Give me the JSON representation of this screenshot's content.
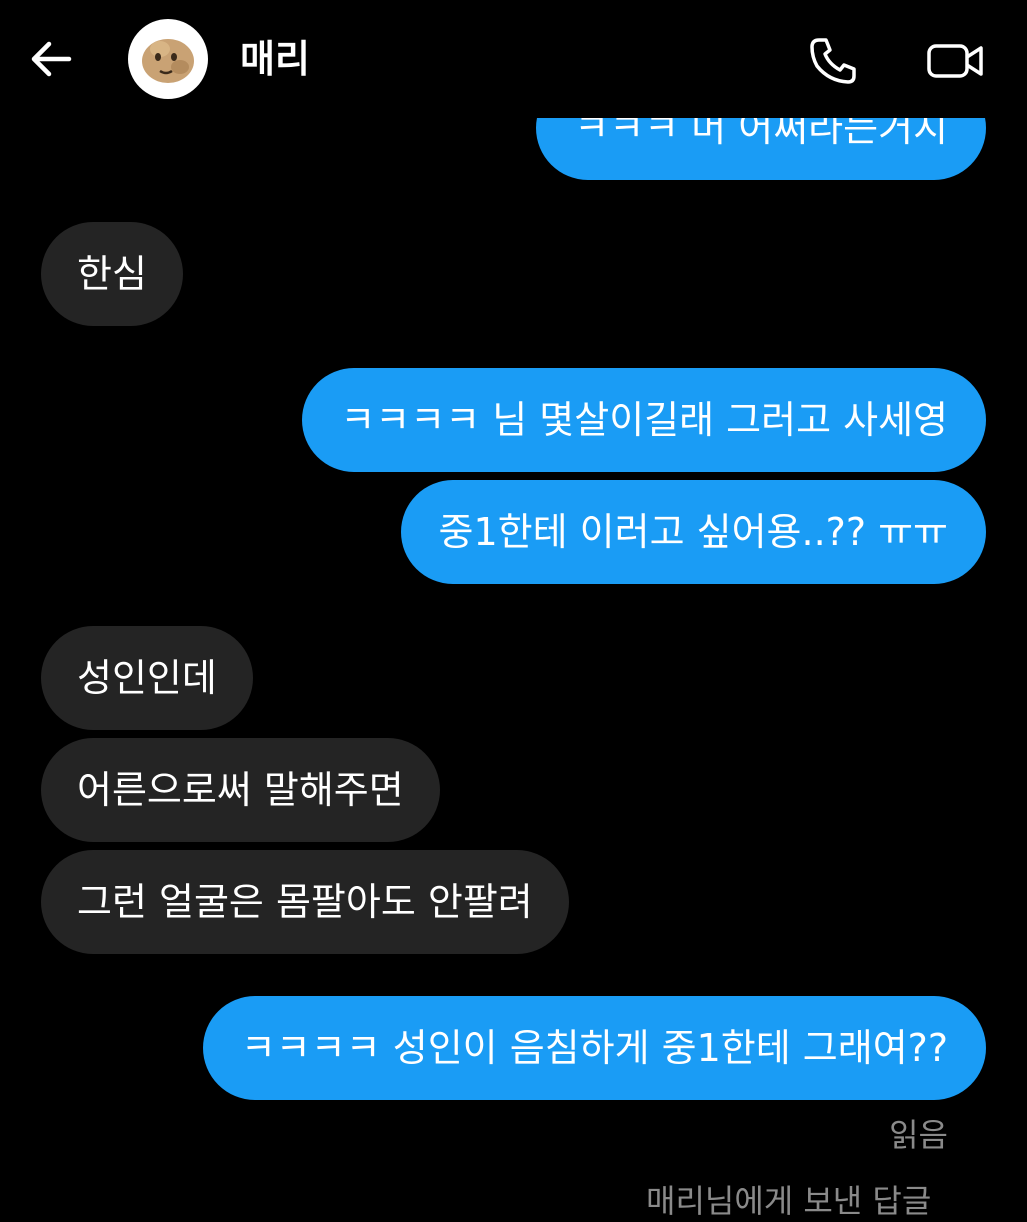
{
  "header": {
    "contact_name": "매리"
  },
  "messages": [
    {
      "side": "sent",
      "text": "ㅋㅋㅋ 머 어쩌라는거지"
    },
    {
      "side": "received",
      "text": "한심"
    },
    {
      "side": "sent",
      "text": "ㅋㅋㅋㅋ 님 몇살이길래 그러고 사세영"
    },
    {
      "side": "sent",
      "text": "중1한테 이러고 싶어용..?? ㅠㅠ"
    },
    {
      "side": "received",
      "text": "성인인데"
    },
    {
      "side": "received",
      "text": "어른으로써 말해주면"
    },
    {
      "side": "received",
      "text": "그런 얼굴은 몸팔아도 안팔려"
    },
    {
      "side": "sent",
      "text": "ㅋㅋㅋㅋ 성인이 음침하게 중1한테 그래여??"
    }
  ],
  "status": {
    "read": "읽음",
    "sent_note": "매리님에게 보낸 답글"
  },
  "colors": {
    "background": "#000000",
    "sent_bubble": "#1a9cf5",
    "received_bubble": "#242424",
    "muted_text": "#8a8a8a"
  }
}
